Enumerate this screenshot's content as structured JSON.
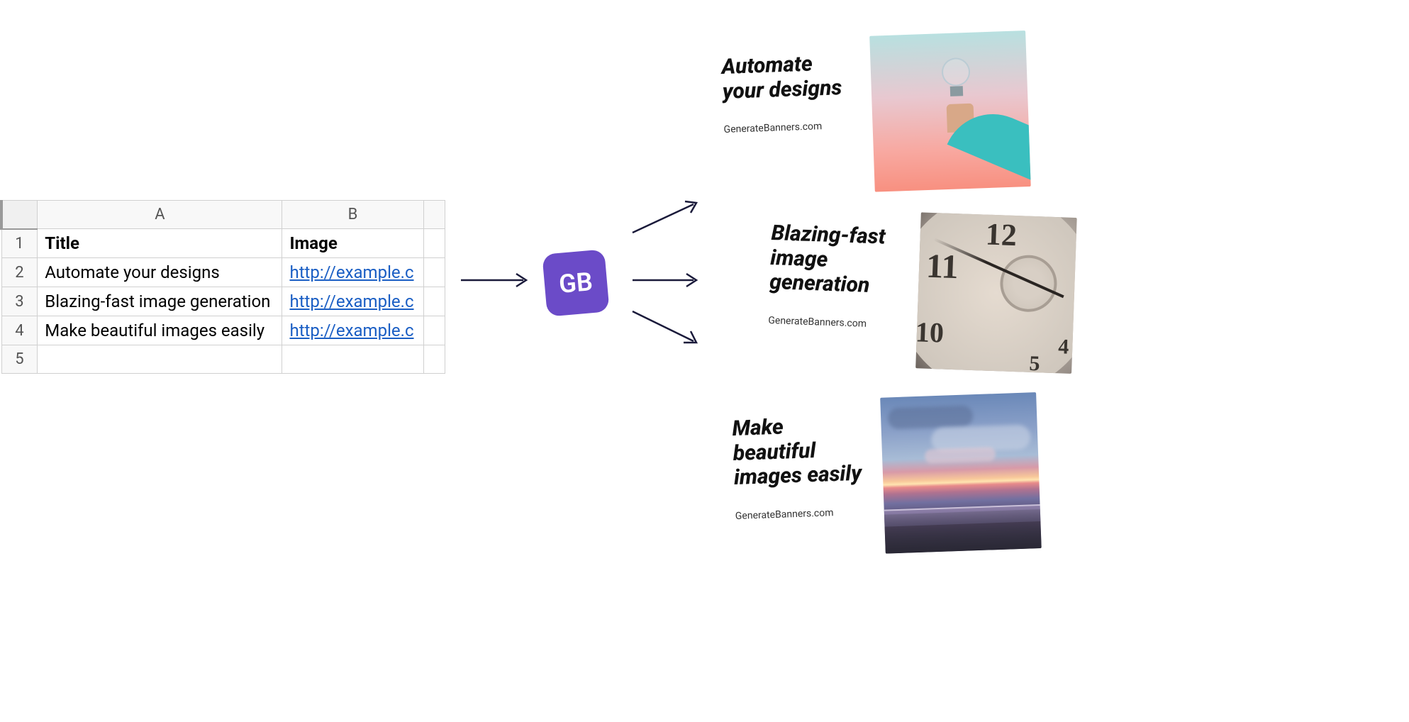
{
  "spreadsheet": {
    "columns": {
      "a": "A",
      "b": "B"
    },
    "headers": {
      "title": "Title",
      "image": "Image"
    },
    "rows": [
      {
        "num": "1"
      },
      {
        "num": "2",
        "title": "Automate your designs",
        "image": "http://example.c"
      },
      {
        "num": "3",
        "title": "Blazing-fast image generation",
        "image": "http://example.c"
      },
      {
        "num": "4",
        "title": "Make beautiful images easily",
        "image": "http://example.c"
      },
      {
        "num": "5"
      }
    ]
  },
  "app": {
    "label": "GB"
  },
  "cards": {
    "footer": "GenerateBanners.com",
    "0": {
      "title": "Automate your designs"
    },
    "1": {
      "title": "Blazing-fast image generation"
    },
    "2": {
      "title": "Make beautiful images easily"
    }
  }
}
